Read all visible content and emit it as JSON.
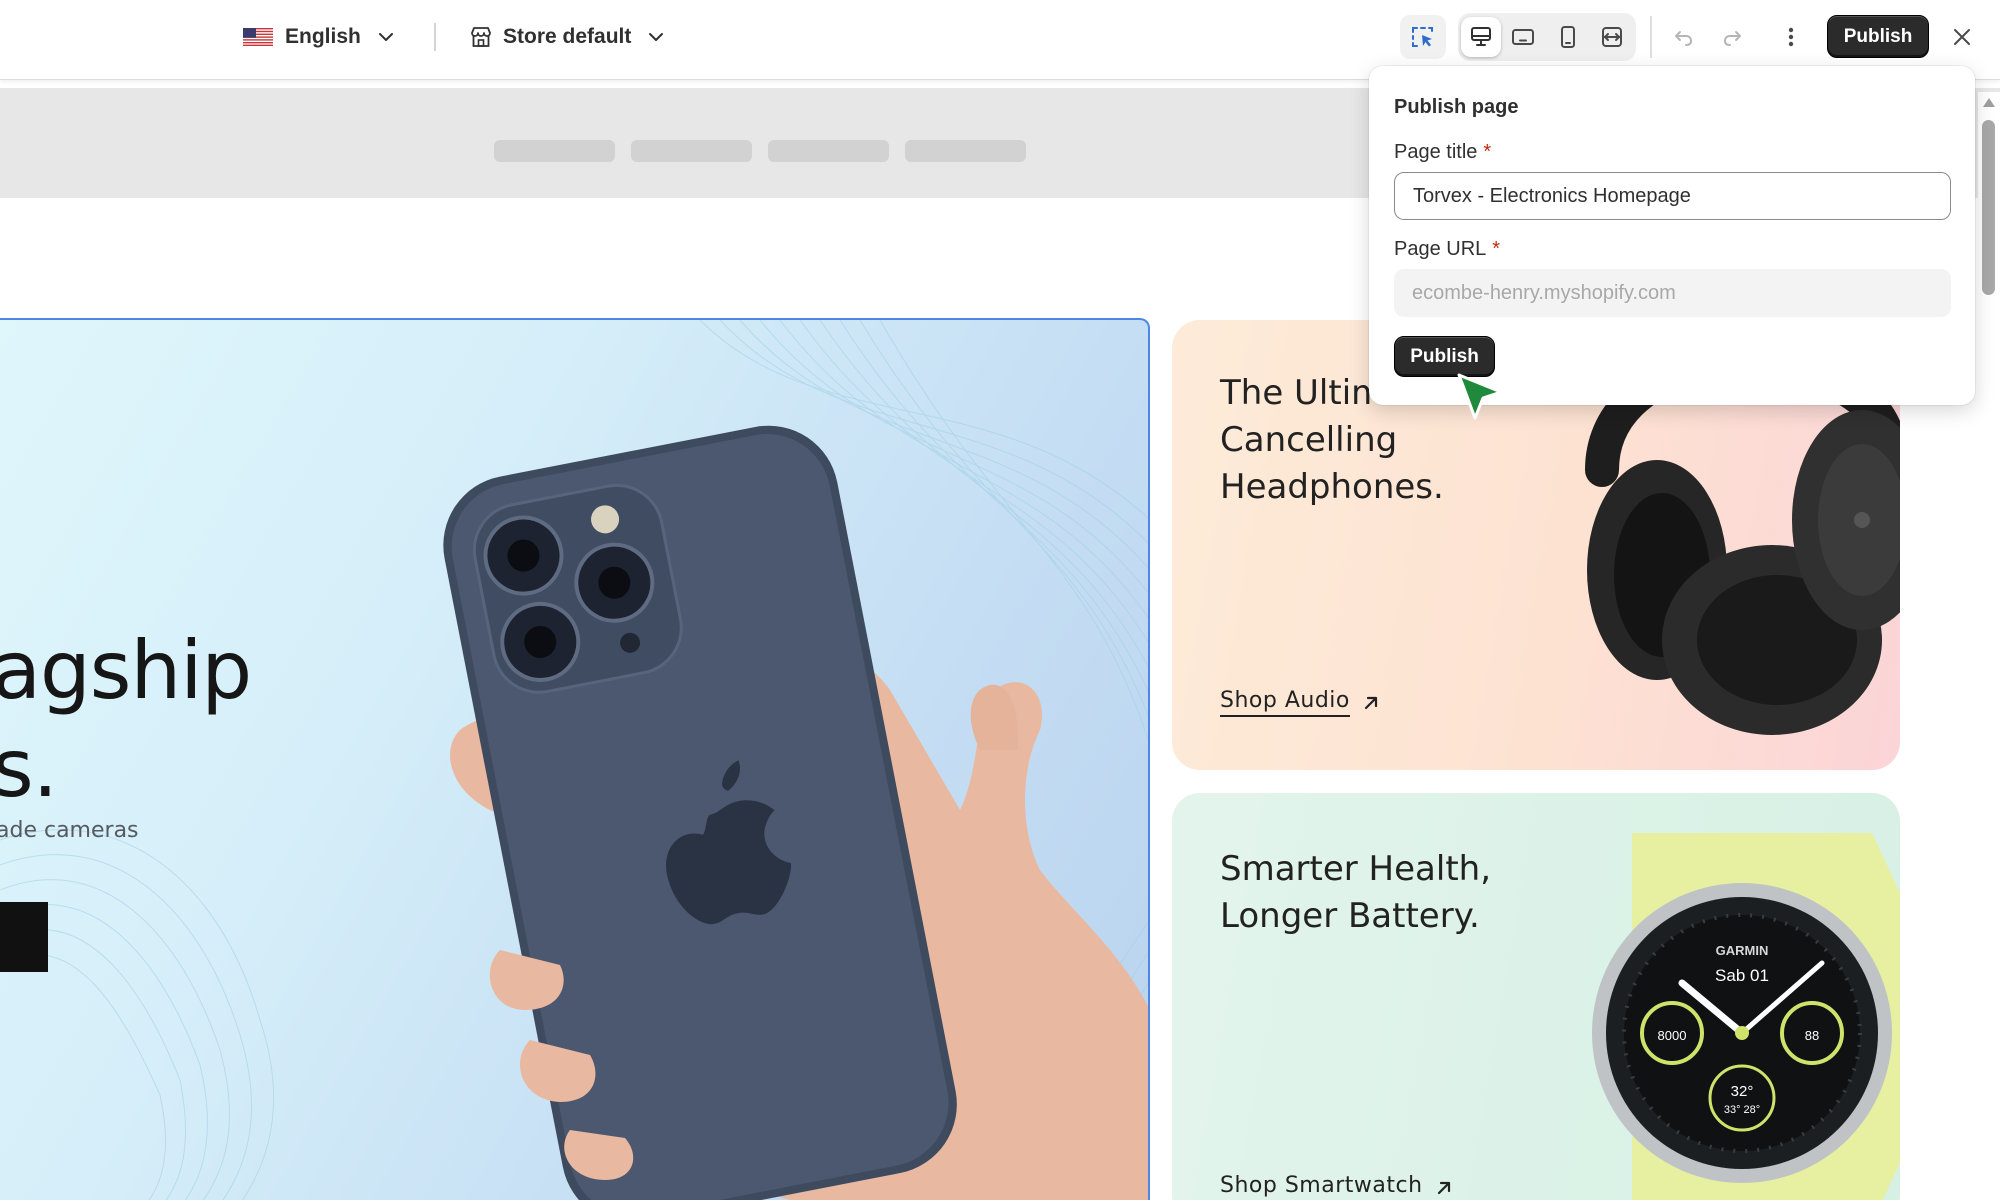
{
  "toolbar": {
    "language": "English",
    "store": "Store default",
    "publish_label": "Publish",
    "icons": {
      "flag": "us-flag-icon",
      "store": "store-icon",
      "select": "select-element-icon",
      "desktop": "desktop-icon",
      "tablet": "tablet-icon",
      "mobile": "mobile-icon",
      "fluid": "fluid-width-icon",
      "undo": "undo-icon",
      "redo": "redo-icon",
      "more": "more-vertical-icon",
      "close": "close-icon"
    },
    "active_device": "desktop"
  },
  "canvas": {
    "hero": {
      "title": "agship\ns.",
      "subtitle": "ade cameras"
    },
    "cards": [
      {
        "title": "The Ultimate Noise\nCancelling\nHeadphones.",
        "link": "Shop Audio"
      },
      {
        "title": "Smarter Health,\nLonger Battery.",
        "link": "Shop Smartwatch",
        "watch_brand": "GARMIN",
        "watch_date": "Sab 01",
        "watch_left": "8000",
        "watch_right": "88",
        "watch_temp": "32°",
        "watch_range": "33° 28°"
      }
    ]
  },
  "publish_popover": {
    "heading": "Publish page",
    "page_title_label": "Page title",
    "page_title_value": "Torvex - Electronics Homepage",
    "page_url_label": "Page URL",
    "page_url_placeholder": "ecombe-henry.myshopify.com",
    "required_mark": "*",
    "publish_label": "Publish"
  },
  "colors": {
    "accent_dark": "#2b2b2b",
    "selection_outline": "#4f86e6",
    "required": "#c5280c",
    "cursor": "#1f8a3c"
  }
}
